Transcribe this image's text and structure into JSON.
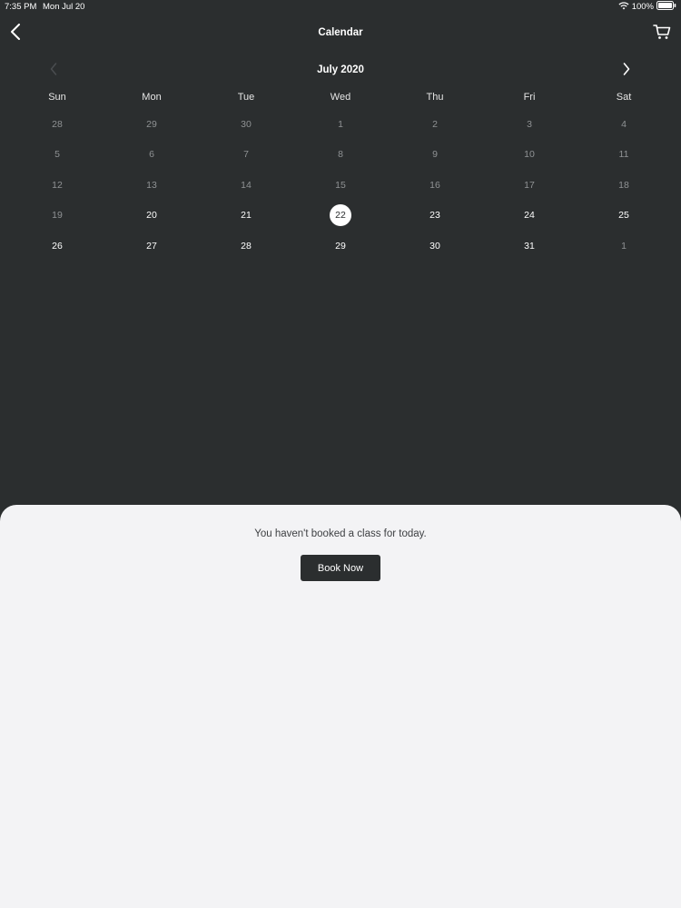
{
  "status": {
    "time": "7:35 PM",
    "date": "Mon Jul 20",
    "battery": "100%"
  },
  "nav": {
    "title": "Calendar"
  },
  "calendar": {
    "month": "July 2020",
    "weekdays": [
      "Sun",
      "Mon",
      "Tue",
      "Wed",
      "Thu",
      "Fri",
      "Sat"
    ],
    "weeks": [
      [
        {
          "d": "28",
          "s": "muted"
        },
        {
          "d": "29",
          "s": "muted"
        },
        {
          "d": "30",
          "s": "muted"
        },
        {
          "d": "1",
          "s": "muted"
        },
        {
          "d": "2",
          "s": "muted"
        },
        {
          "d": "3",
          "s": "muted"
        },
        {
          "d": "4",
          "s": "muted"
        }
      ],
      [
        {
          "d": "5",
          "s": "muted"
        },
        {
          "d": "6",
          "s": "muted"
        },
        {
          "d": "7",
          "s": "muted"
        },
        {
          "d": "8",
          "s": "muted"
        },
        {
          "d": "9",
          "s": "muted"
        },
        {
          "d": "10",
          "s": "muted"
        },
        {
          "d": "11",
          "s": "muted"
        }
      ],
      [
        {
          "d": "12",
          "s": "muted"
        },
        {
          "d": "13",
          "s": "muted"
        },
        {
          "d": "14",
          "s": "muted"
        },
        {
          "d": "15",
          "s": "muted"
        },
        {
          "d": "16",
          "s": "muted"
        },
        {
          "d": "17",
          "s": "muted"
        },
        {
          "d": "18",
          "s": "muted"
        }
      ],
      [
        {
          "d": "19",
          "s": "muted"
        },
        {
          "d": "20",
          "s": "active"
        },
        {
          "d": "21",
          "s": "active"
        },
        {
          "d": "22",
          "s": "today"
        },
        {
          "d": "23",
          "s": "active"
        },
        {
          "d": "24",
          "s": "active"
        },
        {
          "d": "25",
          "s": "active"
        }
      ],
      [
        {
          "d": "26",
          "s": "active"
        },
        {
          "d": "27",
          "s": "active"
        },
        {
          "d": "28",
          "s": "active"
        },
        {
          "d": "29",
          "s": "active"
        },
        {
          "d": "30",
          "s": "active"
        },
        {
          "d": "31",
          "s": "active"
        },
        {
          "d": "1",
          "s": "muted"
        }
      ]
    ]
  },
  "sheet": {
    "message": "You haven't booked a class for today.",
    "button": "Book Now"
  },
  "icons": {
    "back": "chevron-left-icon",
    "cart": "cart-icon",
    "prev": "chevron-left-icon",
    "next": "chevron-right-icon",
    "wifi": "wifi-icon",
    "battery": "battery-icon"
  },
  "colors": {
    "background": "#2b2e2f",
    "sheet": "#f3f3f5",
    "muted_day": "#8f9294",
    "active_day": "#ffffff"
  }
}
